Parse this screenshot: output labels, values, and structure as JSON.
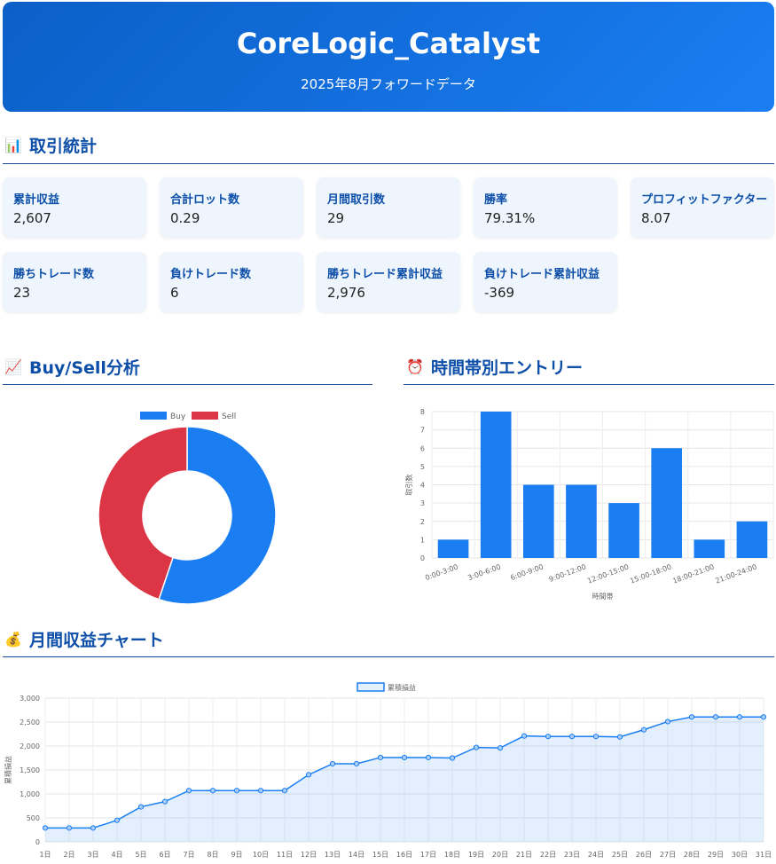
{
  "header": {
    "title": "CoreLogic_Catalyst",
    "subtitle": "2025年8月フォワードデータ"
  },
  "sections": {
    "stats": {
      "icon": "bar-chart-icon",
      "title": "取引統計"
    },
    "buysell": {
      "icon": "trend-chart-icon",
      "title": "Buy/Sell分析"
    },
    "time": {
      "icon": "alarm-clock-icon",
      "title": "時間帯別エントリー"
    },
    "monthly": {
      "icon": "money-bag-icon",
      "title": "月間収益チャート"
    }
  },
  "stats": [
    {
      "label": "累計収益",
      "value": "2,607"
    },
    {
      "label": "合計ロット数",
      "value": "0.29"
    },
    {
      "label": "月間取引数",
      "value": "29"
    },
    {
      "label": "勝率",
      "value": "79.31%"
    },
    {
      "label": "プロフィットファクター",
      "value": "8.07"
    },
    {
      "label": "勝ちトレード数",
      "value": "23"
    },
    {
      "label": "負けトレード数",
      "value": "6"
    },
    {
      "label": "勝ちトレード累計収益",
      "value": "2,976"
    },
    {
      "label": "負けトレード累計収益",
      "value": "-369"
    }
  ],
  "colors": {
    "accent": "#1a7ef2",
    "buy": "#1a7ef2",
    "sell": "#dc3545",
    "heading": "#0d4fa8"
  },
  "chart_data": [
    {
      "type": "pie",
      "variant": "doughnut",
      "categories": [
        "Buy",
        "Sell"
      ],
      "values": [
        16,
        13
      ],
      "colors": [
        "#1a7ef2",
        "#dc3545"
      ],
      "legend": "top"
    },
    {
      "type": "bar",
      "categories": [
        "0:00-3:00",
        "3:00-6:00",
        "6:00-9:00",
        "9:00-12:00",
        "12:00-15:00",
        "15:00-18:00",
        "18:00-21:00",
        "21:00-24:00"
      ],
      "values": [
        1,
        8,
        4,
        4,
        3,
        6,
        1,
        2
      ],
      "xlabel": "時間帯",
      "ylabel": "取引数",
      "ylim": [
        0,
        8
      ],
      "yticks": [
        0,
        1,
        2,
        3,
        4,
        5,
        6,
        7,
        8
      ],
      "grid": true
    },
    {
      "type": "area",
      "x": [
        "1日",
        "2日",
        "3日",
        "4日",
        "5日",
        "6日",
        "7日",
        "8日",
        "9日",
        "10日",
        "11日",
        "12日",
        "13日",
        "14日",
        "15日",
        "16日",
        "17日",
        "18日",
        "19日",
        "20日",
        "21日",
        "22日",
        "23日",
        "24日",
        "25日",
        "26日",
        "27日",
        "28日",
        "29日",
        "30日",
        "31日"
      ],
      "series": [
        {
          "name": "累積損益",
          "values": [
            290,
            290,
            290,
            450,
            730,
            840,
            1070,
            1070,
            1070,
            1070,
            1070,
            1400,
            1630,
            1630,
            1760,
            1760,
            1760,
            1750,
            1970,
            1960,
            2210,
            2200,
            2200,
            2200,
            2190,
            2340,
            2510,
            2607,
            2607,
            2607,
            2607
          ]
        }
      ],
      "ylabel": "累積損益",
      "ylim": [
        0,
        3000
      ],
      "yticks": [
        "0",
        "500",
        "1,000",
        "1,500",
        "2,000",
        "2,500",
        "3,000"
      ],
      "grid": true,
      "legend": "top"
    }
  ]
}
